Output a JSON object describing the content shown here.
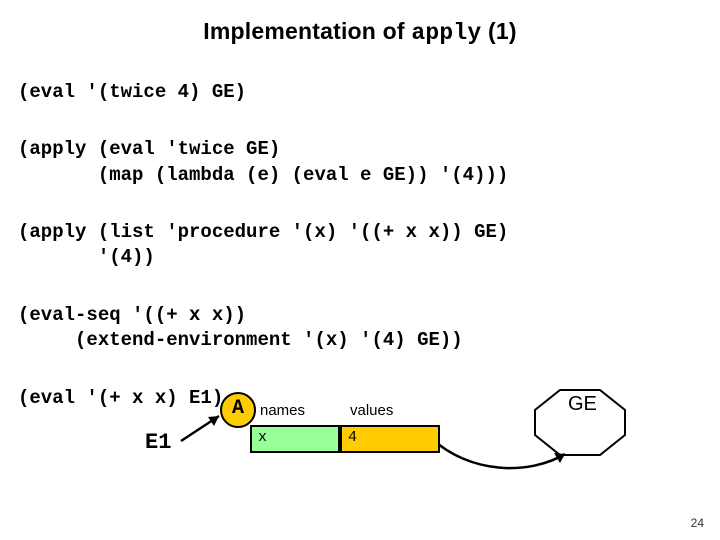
{
  "title": {
    "prefix": "Implementation of ",
    "mono": "apply",
    "suffix": " (1)"
  },
  "code": {
    "l1": "(eval '(twice 4) GE)",
    "l2": "(apply (eval 'twice GE)\n       (map (lambda (e) (eval e GE)) '(4)))",
    "l3": "(apply (list 'procedure '(x) '((+ x x)) GE)\n       '(4))",
    "l4": "(eval-seq '((+ x x))\n     (extend-environment '(x) '(4) GE))",
    "l5": "(eval '(+ x x) E1)"
  },
  "diagram": {
    "e1": "E1",
    "a": "A",
    "names_label": "names",
    "values_label": "values",
    "name_cell": "x",
    "value_cell": "4",
    "ge": "GE"
  },
  "page_number": "24"
}
